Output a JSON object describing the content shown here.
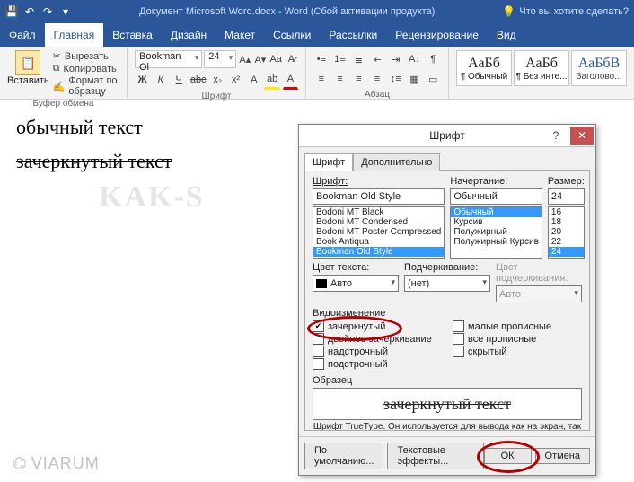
{
  "titlebar": {
    "doc_title": "Документ Microsoft Word.docx - Word (Сбой активации продукта)",
    "tell_me": "Что вы хотите сделать?"
  },
  "menu": {
    "file": "Файл",
    "home": "Главная",
    "insert": "Вставка",
    "design": "Дизайн",
    "layout": "Макет",
    "references": "Ссылки",
    "mailings": "Рассылки",
    "review": "Рецензирование",
    "view": "Вид"
  },
  "ribbon": {
    "clipboard": {
      "paste": "Вставить",
      "cut": "Вырезать",
      "copy": "Копировать",
      "format_painter": "Формат по образцу",
      "group_label": "Буфер обмена"
    },
    "font": {
      "name": "Bookman Ol",
      "size": "24",
      "group_label": "Шрифт",
      "bold": "Ж",
      "italic": "К",
      "underline": "Ч"
    },
    "paragraph": {
      "group_label": "Абзац"
    },
    "styles": {
      "sample": "АаБб",
      "s1": "¶ Обычный",
      "s2": "¶ Без инте...",
      "s3": "Заголово..."
    }
  },
  "document": {
    "line1": "обычный текст",
    "line2": "зачеркнутый текст"
  },
  "watermark": "KAK-S",
  "logo": "VIARUM",
  "dialog": {
    "title": "Шрифт",
    "tab_font": "Шрифт",
    "tab_advanced": "Дополнительно",
    "font_label": "Шрифт:",
    "font_value": "Bookman Old Style",
    "font_list": [
      "Bodoni MT Black",
      "Bodoni MT Condensed",
      "Bodoni MT Poster Compressed",
      "Book Antiqua",
      "Bookman Old Style"
    ],
    "style_label": "Начертание:",
    "style_value": "Обычный",
    "style_list": [
      "Обычный",
      "Курсив",
      "Полужирный",
      "Полужирный Курсив"
    ],
    "size_label": "Размер:",
    "size_value": "24",
    "size_list": [
      "16",
      "18",
      "20",
      "22",
      "24"
    ],
    "color_label": "Цвет текста:",
    "color_value": "Авто",
    "under_label": "Подчеркивание:",
    "under_value": "(нет)",
    "under_color_label": "Цвет подчеркивания:",
    "under_color_value": "Авто",
    "effects_label": "Видоизменение",
    "eff": {
      "strike": "зачеркнутый",
      "dblstrike": "двойное зачеркивание",
      "super": "надстрочный",
      "sub": "подстрочный",
      "smallcaps": "малые прописные",
      "allcaps": "все прописные",
      "hidden": "скрытый"
    },
    "preview_label": "Образец",
    "preview_text": "зачеркнутый текст",
    "hint": "Шрифт TrueType. Он используется для вывода как на экран, так и на принтер.",
    "btn_default": "По умолчанию...",
    "btn_texteff": "Текстовые эффекты...",
    "btn_ok": "ОК",
    "btn_cancel": "Отмена"
  }
}
